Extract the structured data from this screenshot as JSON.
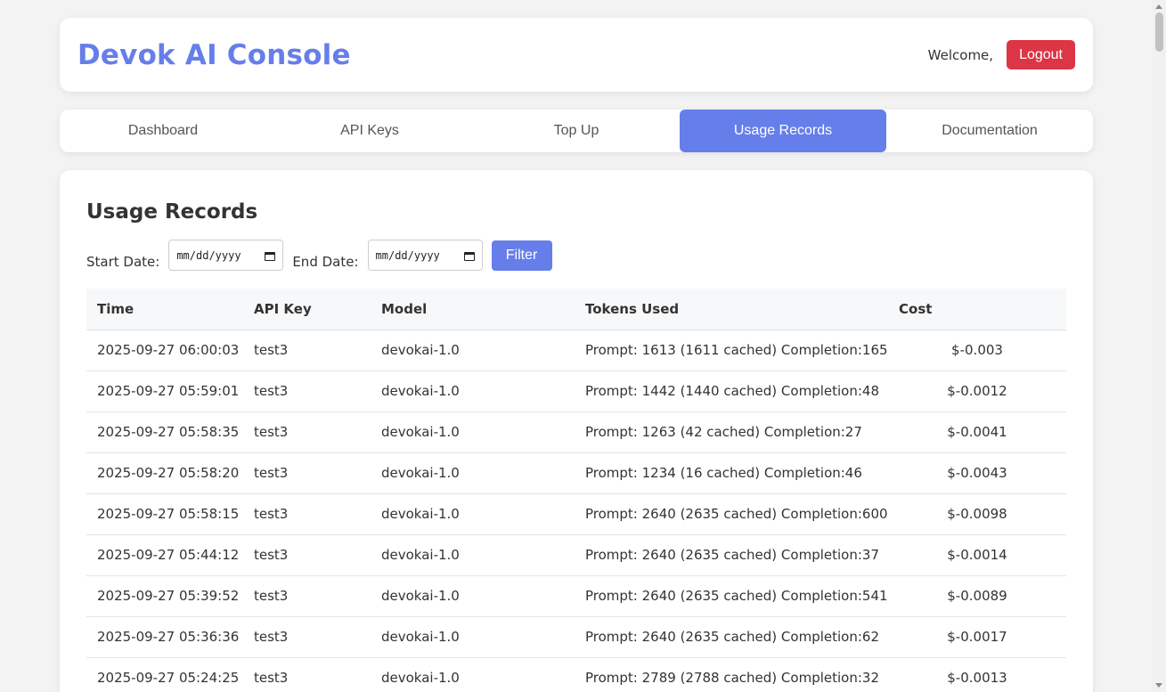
{
  "header": {
    "brand": "Devok AI Console",
    "welcome": "Welcome,",
    "logout_label": "Logout"
  },
  "tabs": [
    {
      "label": "Dashboard",
      "active": false
    },
    {
      "label": "API Keys",
      "active": false
    },
    {
      "label": "Top Up",
      "active": false
    },
    {
      "label": "Usage Records",
      "active": true
    },
    {
      "label": "Documentation",
      "active": false
    }
  ],
  "main": {
    "title": "Usage Records",
    "filter": {
      "start_label": "Start Date:",
      "start_placeholder": "mm/dd/yyyy",
      "end_label": "End Date:",
      "end_placeholder": "mm/dd/yyyy",
      "button_label": "Filter"
    },
    "table": {
      "headers": [
        "Time",
        "API Key",
        "Model",
        "Tokens Used",
        "Cost"
      ],
      "rows": [
        [
          "2025-09-27 06:00:03",
          "test3",
          "devokai-1.0",
          "Prompt: 1613 (1611 cached) Completion:165",
          "$-0.003"
        ],
        [
          "2025-09-27 05:59:01",
          "test3",
          "devokai-1.0",
          "Prompt: 1442 (1440 cached) Completion:48",
          "$-0.0012"
        ],
        [
          "2025-09-27 05:58:35",
          "test3",
          "devokai-1.0",
          "Prompt: 1263 (42 cached) Completion:27",
          "$-0.0041"
        ],
        [
          "2025-09-27 05:58:20",
          "test3",
          "devokai-1.0",
          "Prompt: 1234 (16 cached) Completion:46",
          "$-0.0043"
        ],
        [
          "2025-09-27 05:58:15",
          "test3",
          "devokai-1.0",
          "Prompt: 2640 (2635 cached) Completion:600",
          "$-0.0098"
        ],
        [
          "2025-09-27 05:44:12",
          "test3",
          "devokai-1.0",
          "Prompt: 2640 (2635 cached) Completion:37",
          "$-0.0014"
        ],
        [
          "2025-09-27 05:39:52",
          "test3",
          "devokai-1.0",
          "Prompt: 2640 (2635 cached) Completion:541",
          "$-0.0089"
        ],
        [
          "2025-09-27 05:36:36",
          "test3",
          "devokai-1.0",
          "Prompt: 2640 (2635 cached) Completion:62",
          "$-0.0017"
        ],
        [
          "2025-09-27 05:24:25",
          "test3",
          "devokai-1.0",
          "Prompt: 2789 (2788 cached) Completion:32",
          "$-0.0013"
        ]
      ]
    }
  },
  "colors": {
    "accent": "#667eea",
    "danger": "#dc3545"
  },
  "icons": {
    "calendar": "calendar-icon"
  }
}
